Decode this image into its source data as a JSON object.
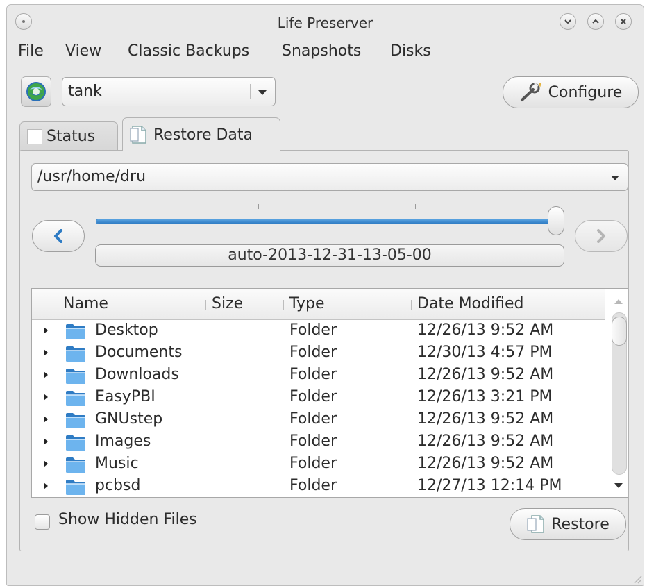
{
  "window": {
    "title": "Life Preserver"
  },
  "menubar": {
    "items": [
      "File",
      "View",
      "Classic Backups",
      "Snapshots",
      "Disks"
    ]
  },
  "toolbar": {
    "pool_value": "tank",
    "configure_label": "Configure"
  },
  "tabs": [
    {
      "label": "Status",
      "active": false
    },
    {
      "label": "Restore Data",
      "active": true
    }
  ],
  "restore": {
    "path_value": "/usr/home/dru",
    "snapshot_label": "auto-2013-12-31-13-05-00",
    "slider_position": 1.0
  },
  "tree": {
    "columns": [
      "Name",
      "Size",
      "Type",
      "Date Modified"
    ],
    "rows": [
      {
        "name": "Desktop",
        "size": "",
        "type": "Folder",
        "date": "12/26/13 9:52 AM"
      },
      {
        "name": "Documents",
        "size": "",
        "type": "Folder",
        "date": "12/30/13 4:57 PM"
      },
      {
        "name": "Downloads",
        "size": "",
        "type": "Folder",
        "date": "12/26/13 9:52 AM"
      },
      {
        "name": "EasyPBI",
        "size": "",
        "type": "Folder",
        "date": "12/26/13 3:21 PM"
      },
      {
        "name": "GNUstep",
        "size": "",
        "type": "Folder",
        "date": "12/26/13 9:52 AM"
      },
      {
        "name": "Images",
        "size": "",
        "type": "Folder",
        "date": "12/26/13 9:52 AM"
      },
      {
        "name": "Music",
        "size": "",
        "type": "Folder",
        "date": "12/26/13 9:52 AM"
      },
      {
        "name": "pcbsd",
        "size": "",
        "type": "Folder",
        "date": "12/27/13 12:14 PM"
      }
    ]
  },
  "footer": {
    "show_hidden_label": "Show Hidden Files",
    "show_hidden_checked": false,
    "restore_label": "Restore"
  },
  "colors": {
    "accent": "#3d87c8",
    "folder": "#4a9be0",
    "window_bg": "#e9e9e9"
  },
  "icons": [
    "window-menu-icon",
    "minimize-icon",
    "maximize-icon",
    "close-icon",
    "life-preserver-app-icon",
    "wrench-icon",
    "document-icon",
    "folder-icon",
    "chevron-left-icon",
    "chevron-right-icon"
  ]
}
